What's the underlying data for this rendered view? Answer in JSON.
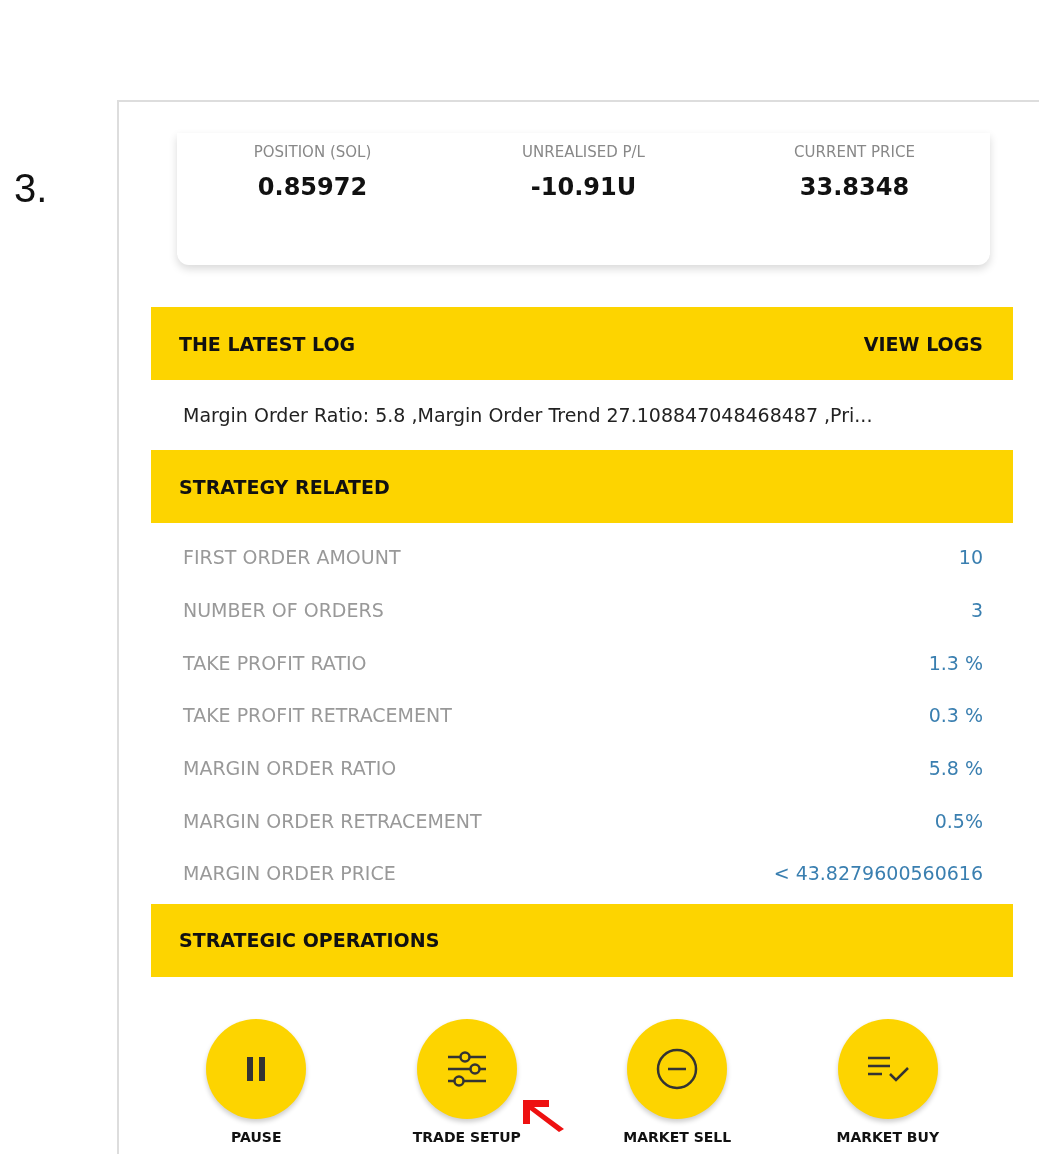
{
  "step_number": "3.",
  "summary": [
    {
      "label": "POSITION (SOL)",
      "value": "0.85972"
    },
    {
      "label": "UNREALISED P/L",
      "value": "-10.91U"
    },
    {
      "label": "CURRENT PRICE",
      "value": "33.8348"
    }
  ],
  "latest_log": {
    "title": "THE LATEST LOG",
    "link": "VIEW LOGS",
    "text": "Margin Order Ratio: 5.8 ,Margin Order Trend 27.108847048468487 ,Pri..."
  },
  "strategy": {
    "title": "STRATEGY RELATED",
    "rows": [
      {
        "label": "FIRST ORDER AMOUNT",
        "value": "10"
      },
      {
        "label": "NUMBER OF ORDERS",
        "value": "3"
      },
      {
        "label": "TAKE PROFIT RATIO",
        "value": "1.3 %"
      },
      {
        "label": "TAKE PROFIT RETRACEMENT",
        "value": "0.3 %"
      },
      {
        "label": "MARGIN ORDER RATIO",
        "value": "5.8 %"
      },
      {
        "label": "MARGIN ORDER RETRACEMENT",
        "value": "0.5%"
      },
      {
        "label": "MARGIN ORDER PRICE",
        "value": "< 43.8279600560616"
      }
    ]
  },
  "operations": {
    "title": "STRATEGIC OPERATIONS",
    "actions": [
      {
        "kind": "pause",
        "label": "PAUSE"
      },
      {
        "kind": "setup",
        "label": "TRADE SETUP"
      },
      {
        "kind": "sell",
        "label": "MARKET SELL"
      },
      {
        "kind": "buy",
        "label": "MARKET BUY"
      }
    ]
  }
}
